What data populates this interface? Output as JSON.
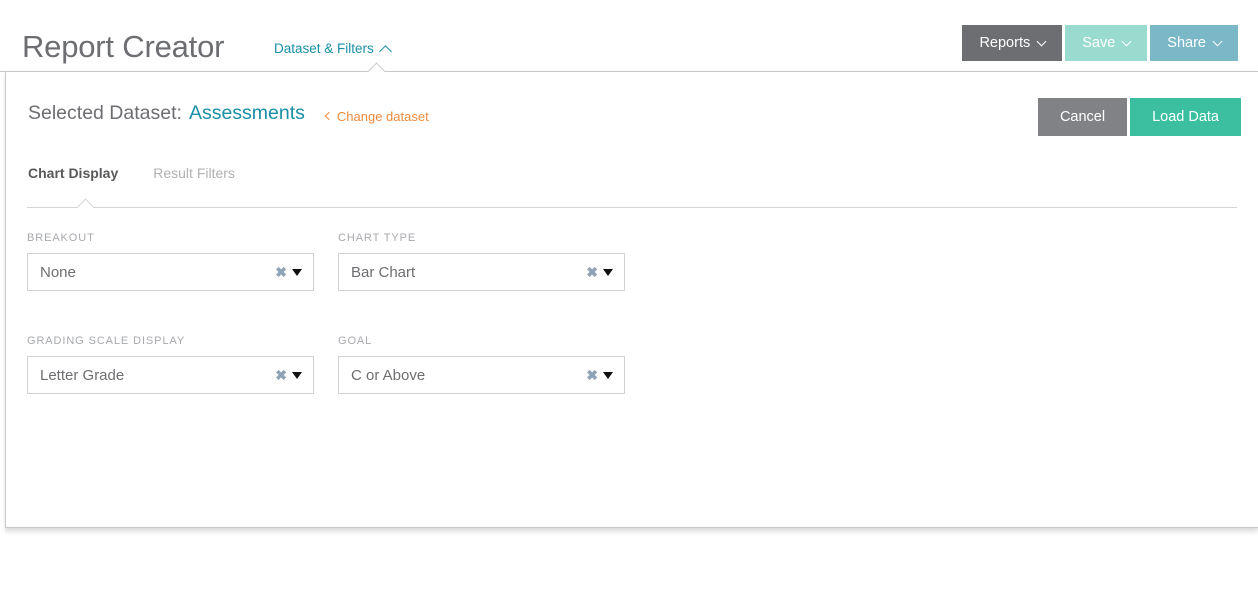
{
  "header": {
    "app_title": "Report Creator",
    "dataset_filters_toggle": "Dataset & Filters",
    "buttons": {
      "reports": "Reports",
      "save": "Save",
      "share": "Share"
    },
    "colors": {
      "reports_bg": "#6d6e71",
      "save_bg": "#9adbd0",
      "share_bg": "#7ab8c8",
      "link_teal": "#1a8fa5"
    }
  },
  "panel": {
    "dataset_label": "Selected Dataset:",
    "dataset_value": "Assessments",
    "change_dataset": "Change dataset",
    "change_dataset_color": "#f08a3c",
    "actions": {
      "cancel": "Cancel",
      "load_data": "Load Data",
      "cancel_bg": "#808285",
      "load_data_bg": "#3bbfa0"
    },
    "tabs": [
      {
        "label": "Chart Display",
        "active": true
      },
      {
        "label": "Result Filters",
        "active": false
      }
    ],
    "fields": [
      {
        "label": "BREAKOUT",
        "value": "None",
        "clear_icon": "clear-x-icon",
        "caret_icon": "chevron-down-icon"
      },
      {
        "label": "CHART TYPE",
        "value": "Bar Chart",
        "clear_icon": "clear-x-icon",
        "caret_icon": "chevron-down-icon"
      },
      {
        "label": "GRADING SCALE DISPLAY",
        "value": "Letter Grade",
        "clear_icon": "clear-x-icon",
        "caret_icon": "chevron-down-icon"
      },
      {
        "label": "GOAL",
        "value": "C or Above",
        "clear_icon": "clear-x-icon",
        "caret_icon": "chevron-down-icon"
      }
    ]
  },
  "icons": {
    "clear_x": "✖",
    "chevron_up": "chevron-up-icon",
    "chevron_down": "chevron-down-icon",
    "chevron_left": "chevron-left-icon"
  }
}
